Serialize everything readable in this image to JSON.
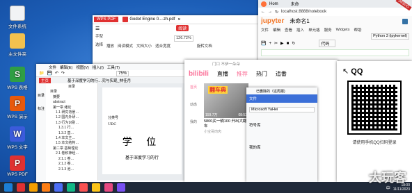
{
  "desktop": {
    "icons": [
      {
        "label": "文件系统",
        "color": "#e8f0fb"
      },
      {
        "label": "主文件夹",
        "color": "#f2c14e"
      },
      {
        "label": "WPS 表格",
        "color": "#2f9e44"
      },
      {
        "label": "WPS 演示",
        "color": "#e8590c"
      },
      {
        "label": "WPS 文字",
        "color": "#3b5bdb"
      },
      {
        "label": "WPS PDF",
        "color": "#e03131"
      }
    ]
  },
  "wps_pdf": {
    "app_tab": "WPS PDF",
    "doc_tab": "Godot Engine 0...-zh.pdf",
    "badge": "阅读",
    "tools": [
      "手型",
      "选择",
      "播放",
      "阅读模式",
      "文档大小",
      "适合宽度",
      "适合页面",
      "旋转文档"
    ],
    "zoom": "126.72%"
  },
  "wps_writer": {
    "menus": [
      "文件",
      "编辑(E)",
      "视图(V)",
      "插入(I)",
      "工具(T)"
    ],
    "zoom": "75%",
    "tabs": [
      "目录",
      "基于深度学习的行…究与实现_林佳月"
    ],
    "side_tools": [
      "目录",
      "标注"
    ],
    "toc_title": "目录",
    "toc": [
      "目录",
      "摘要",
      "abstract",
      "第一章 绪论",
      "1.1 研究背景…",
      "1.2 国内外研…",
      "1.3 行为识别…",
      "1.3.1 行…",
      "1.3.2 基…",
      "1.4 本文主…",
      "1.5 本文结构…",
      "第二章 基础理论",
      "2.1 卷积神经…",
      "2.1.1 卷…",
      "2.1.2 卷…",
      "2.1.3 池…"
    ],
    "doc_head1": "分类号",
    "doc_head2": "UDC",
    "doc_big": "学 位",
    "doc_sub": "基于深度学习的行"
  },
  "jupyter": {
    "tab": "Hom",
    "tab2": "未命",
    "url": "localhost:8888/notebook",
    "logo": "jupyter",
    "title": "未命名1",
    "menu": [
      "文件",
      "编辑",
      "查看",
      "插入",
      "单元格",
      "服务",
      "Widgets",
      "帮助"
    ],
    "kernel": "Python 3 (ipykernel)",
    "cell_type": "代码",
    "debug": "DEBUG"
  },
  "bilibili": {
    "brand": "bilibili",
    "search": "门口 不伊一朵朵",
    "nav": [
      "直播",
      "推荐",
      "热门",
      "追番"
    ],
    "sidebar": [
      "首页",
      "动态",
      "我的"
    ],
    "video_title": "5800买一辆100 开出大翻车",
    "views": "159.7万",
    "duration": "08:52",
    "thumb_text": "翻车典",
    "author": "小宝哥肉肉"
  },
  "wps_mini": {
    "title": "已删除的（这周报)",
    "font": "Microsoft YaHei",
    "file_label": "文件",
    "panels": [
      "符号库",
      "我的库"
    ],
    "items": [
      "符号库",
      "我的库"
    ]
  },
  "qq": {
    "title": "QQ",
    "caption": "请使用手机QQ扫码登录"
  },
  "taskbar": {
    "lang": "中",
    "time": "18:00",
    "date": "11/11/2023",
    "watermark": "大玩客"
  }
}
